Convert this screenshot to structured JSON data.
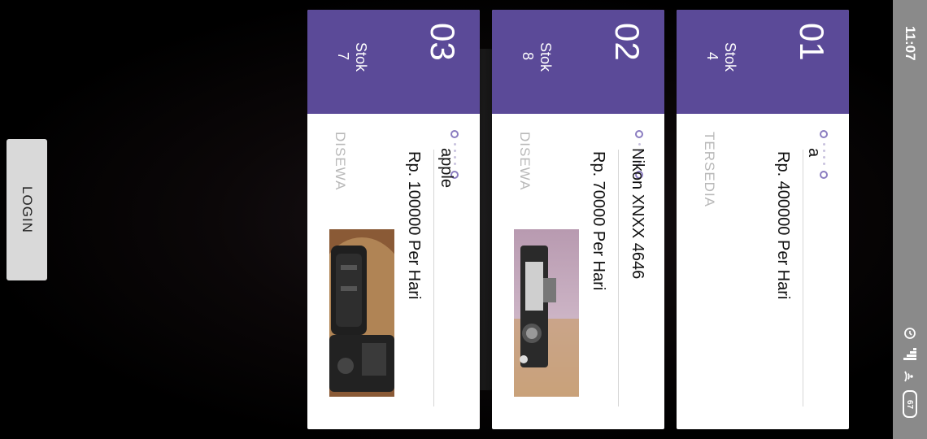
{
  "status_bar": {
    "time": "11:07",
    "battery": "67",
    "icons": [
      "alarm-icon",
      "signal-icon",
      "wifi-icon",
      "battery-icon"
    ]
  },
  "login": {
    "label": "LOGIN"
  },
  "cards": [
    {
      "number": "01",
      "stok_label": "Stok",
      "stok_value": "4",
      "name": "a",
      "price": "Rp. 400000 Per Hari",
      "status": "TERSEDIA",
      "has_photo": false
    },
    {
      "number": "02",
      "stok_label": "Stok",
      "stok_value": "8",
      "name": "Nikon XNXX 4646",
      "price": "Rp. 70000 Per Hari",
      "status": "DISEWA",
      "has_photo": true
    },
    {
      "number": "03",
      "stok_label": "Stok",
      "stok_value": "7",
      "name": "apple",
      "price": "Rp. 100000 Per Hari",
      "status": "DISEWA",
      "has_photo": true
    }
  ],
  "colors": {
    "header": "#5b4a98",
    "status_bar": "#8a8a8a",
    "accent_ring": "#8a7cc0"
  }
}
